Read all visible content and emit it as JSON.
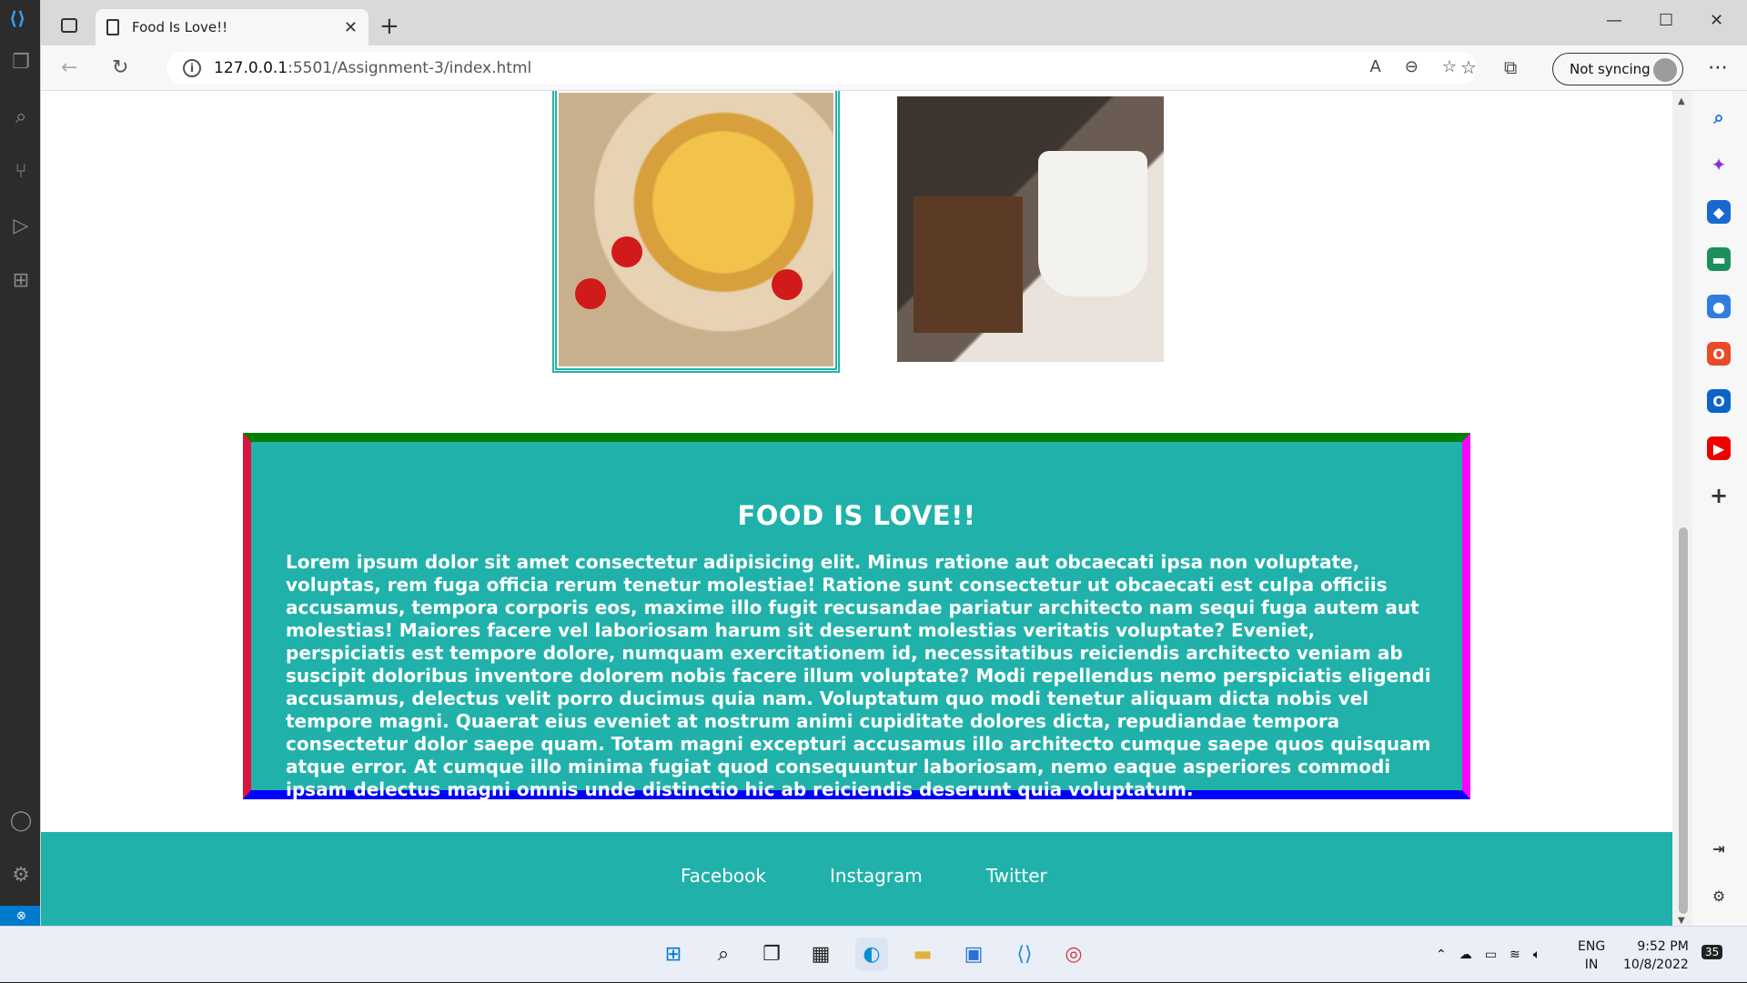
{
  "browser": {
    "tab_title": "Food Is Love!!",
    "url_host": "127.0.0.1",
    "url_path": ":5501/Assignment-3/index.html",
    "sync_label": "Not syncing"
  },
  "page": {
    "heading": "FOOD IS LOVE!!",
    "body": "Lorem ipsum dolor sit amet consectetur adipisicing elit. Minus ratione aut obcaecati ipsa non voluptate, voluptas, rem fuga officia rerum tenetur molestiae! Ratione sunt consectetur ut obcaecati est culpa officiis accusamus, tempora corporis eos, maxime illo fugit recusandae pariatur architecto nam sequi fuga autem aut molestias! Maiores facere vel laboriosam harum sit deserunt molestias veritatis voluptate? Eveniet, perspiciatis est tempore dolore, numquam exercitationem id, necessitatibus reiciendis architecto veniam ab suscipit doloribus inventore dolorem nobis facere illum voluptate? Modi repellendus nemo perspiciatis eligendi accusamus, delectus velit porro ducimus quia nam. Voluptatum quo modi tenetur aliquam dicta nobis vel tempore magni. Quaerat eius eveniet at nostrum animi cupiditate dolores dicta, repudiandae tempora consectetur dolor saepe quam. Totam magni excepturi accusamus illo architecto cumque saepe quos quisquam atque error. At cumque illo minima fugiat quod consequuntur laboriosam, nemo eaque asperiores commodi ipsam delectus magni omnis unde distinctio hic ab reiciendis deserunt quia voluptatum.",
    "footer_links": [
      "Facebook",
      "Instagram",
      "Twitter"
    ]
  },
  "colors": {
    "teal": "#20b2aa",
    "border_top": "#008000",
    "border_right": "#ff00ff",
    "border_bottom": "#0000ff",
    "border_left": "#dc143c"
  },
  "taskbar": {
    "time": "9:52 PM",
    "date": "10/8/2022",
    "lang1": "ENG",
    "lang2": "IN",
    "notif_count": "35"
  }
}
